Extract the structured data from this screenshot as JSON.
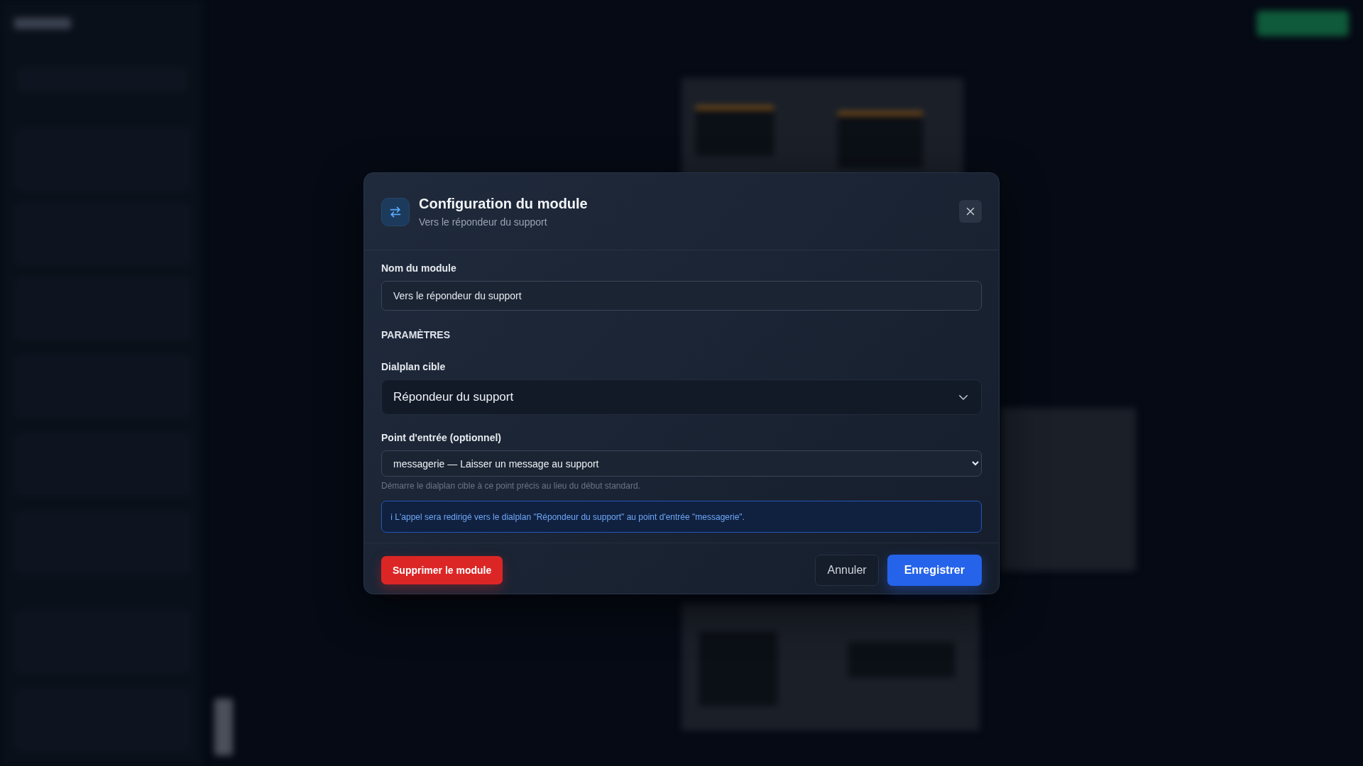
{
  "modal": {
    "title": "Configuration du module",
    "subtitle": "Vers le répondeur du support",
    "fields": [
      {
        "kind": "text",
        "label": "Nom du module",
        "value": "Vers le répondeur du support"
      },
      {
        "kind": "section",
        "label": "PARAMÈTRES"
      },
      {
        "kind": "dropdown",
        "label": "Dialplan cible",
        "value": "Répondeur du support"
      },
      {
        "kind": "select",
        "label": "Point d'entrée (optionnel)",
        "value": "messagerie — Laisser un message au support",
        "hint": "Démarre le dialplan cible à ce point précis au lieu du début standard."
      },
      {
        "kind": "info",
        "text": "ℹ L'appel sera redirigé vers le dialplan \"Répondeur du support\" au point d'entrée \"messagerie\"."
      }
    ],
    "buttons": [
      {
        "kind": "danger",
        "label": "Supprimer le module"
      },
      {
        "kind": "secondary",
        "label": "Annuler"
      },
      {
        "kind": "primary",
        "label": "Enregistrer"
      }
    ]
  }
}
